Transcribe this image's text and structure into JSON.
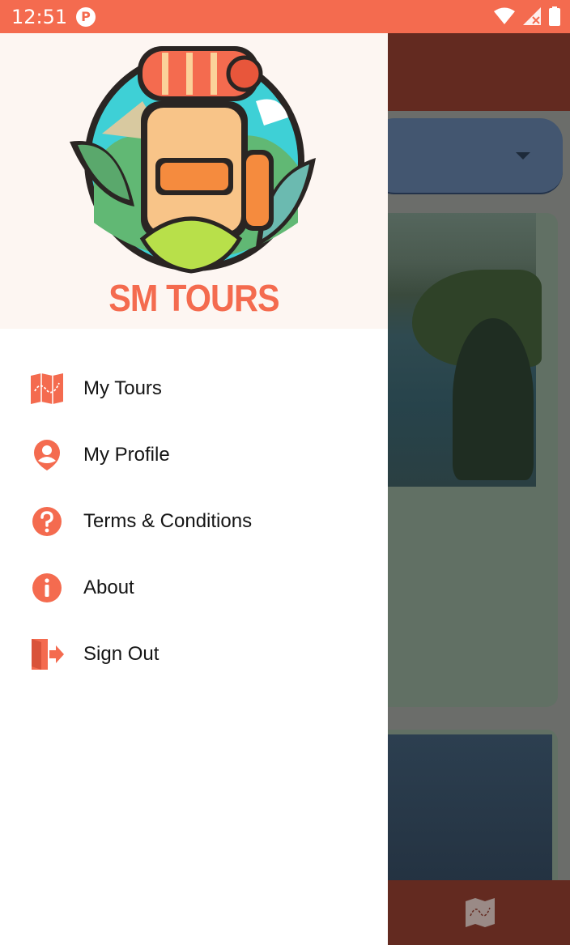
{
  "status_bar": {
    "time": "12:51",
    "app_icon_letter": "P",
    "icons": [
      "wifi-icon",
      "signal-icon",
      "battery-icon"
    ]
  },
  "drawer": {
    "brand": "SM TOURS",
    "menu": [
      {
        "label": "My Tours",
        "icon": "map-icon"
      },
      {
        "label": "My Profile",
        "icon": "profile-icon"
      },
      {
        "label": "Terms & Conditions",
        "icon": "help-icon"
      },
      {
        "label": "About",
        "icon": "info-icon"
      },
      {
        "label": "Sign Out",
        "icon": "sign-out-icon"
      }
    ]
  },
  "colors": {
    "accent": "#f46b4f",
    "toolbar": "#632a20",
    "drawer_header_bg": "#fdf6f2"
  }
}
